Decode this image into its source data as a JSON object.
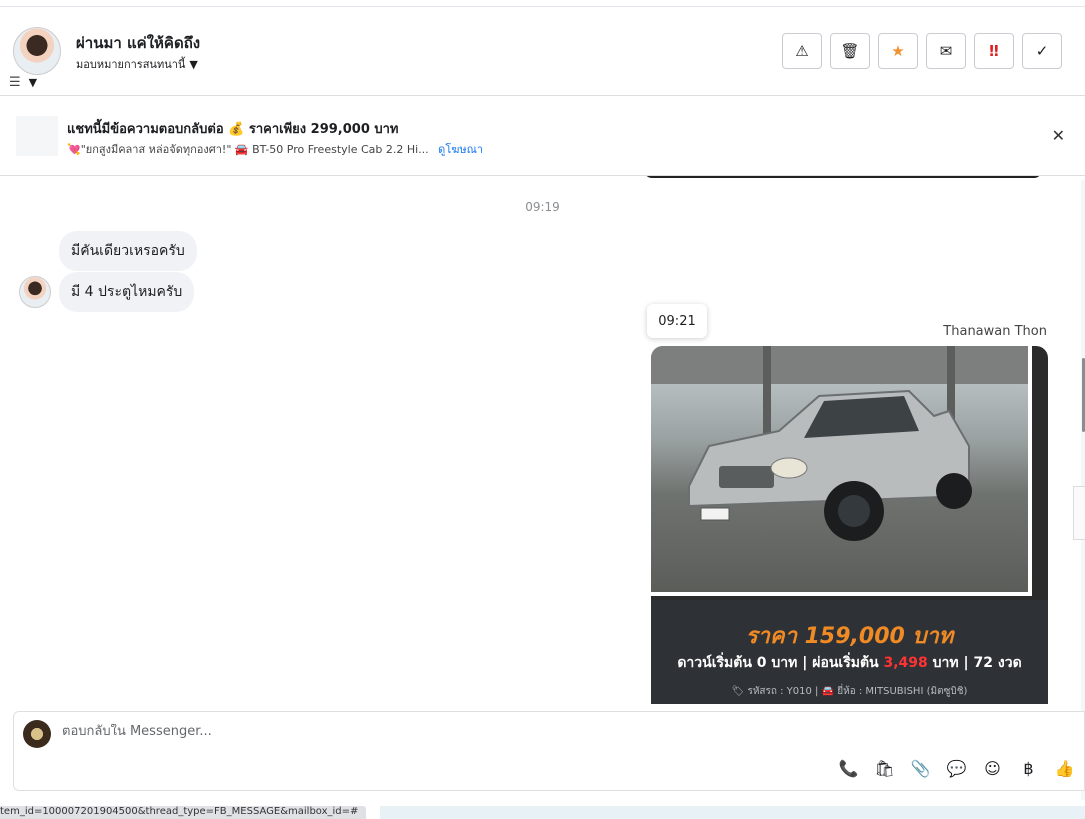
{
  "header": {
    "contact_name": "ผ่านมา แค่ให้คิดถึง",
    "assign_label": "มอบหมายการสนทนานี้",
    "actions": [
      {
        "name": "report-button",
        "icon": "warning-icon",
        "glyph": "⚠"
      },
      {
        "name": "delete-button",
        "icon": "trash-icon",
        "glyph": "🗑"
      },
      {
        "name": "star-button",
        "icon": "star-icon",
        "glyph": "★"
      },
      {
        "name": "mark-unread-button",
        "icon": "envelope-icon",
        "glyph": "✉"
      },
      {
        "name": "follow-up-button",
        "icon": "urgent-icon",
        "glyph": "‼"
      },
      {
        "name": "mark-done-button",
        "icon": "check-icon",
        "glyph": "✓"
      }
    ]
  },
  "banner": {
    "title": "แชทนี้มีข้อความตอบกลับต่อ 💰 ราคาเพียง 299,000 บาท",
    "subtitle": "💘\"ยกสูงมีคลาส หล่อจัดทุกองศา!\" 🚘 BT-50 Pro Freestyle Cab 2.2 Hi...",
    "link": "ดูโฆษณา",
    "close_glyph": "✕"
  },
  "chat": {
    "time_divider": "09:19",
    "incoming": [
      "มีคันเดียวเหรอครับ",
      "มี 4 ประตูไหมครับ"
    ],
    "tooltip_time": "09:21",
    "sender": "Thanawan Thon",
    "card": {
      "price": "ราคา 159,000 บาท",
      "terms_prefix": "ดาวน์เริ่มต้น 0 บาท | ผ่อนเริ่มต้น ",
      "terms_highlight": "3,498",
      "terms_suffix": " บาท | 72 งวด",
      "code_line": "🏷 รหัสรถ : Y010 | 🚘 ยี่ห้อ : MITSUBISHI (มิตซูบิชิ)"
    }
  },
  "composer": {
    "placeholder": "ตอบกลับใน Messenger...",
    "tools": [
      {
        "name": "call-add-icon",
        "glyph": "📞"
      },
      {
        "name": "shopping-bag-icon",
        "glyph": "🛍"
      },
      {
        "name": "attachment-icon",
        "glyph": "📎"
      },
      {
        "name": "saved-reply-icon",
        "glyph": "💬"
      },
      {
        "name": "emoji-icon",
        "glyph": "☺"
      },
      {
        "name": "baht-icon",
        "glyph": "฿"
      },
      {
        "name": "thumbs-up-icon",
        "glyph": "👍"
      }
    ]
  },
  "status_bar": "tem_id=100007201904500&thread_type=FB_MESSAGE&mailbox_id=#",
  "colors": {
    "accent": "#1877f2",
    "price": "#f08a24",
    "highlight": "#ff3333",
    "star": "#f0922e"
  }
}
